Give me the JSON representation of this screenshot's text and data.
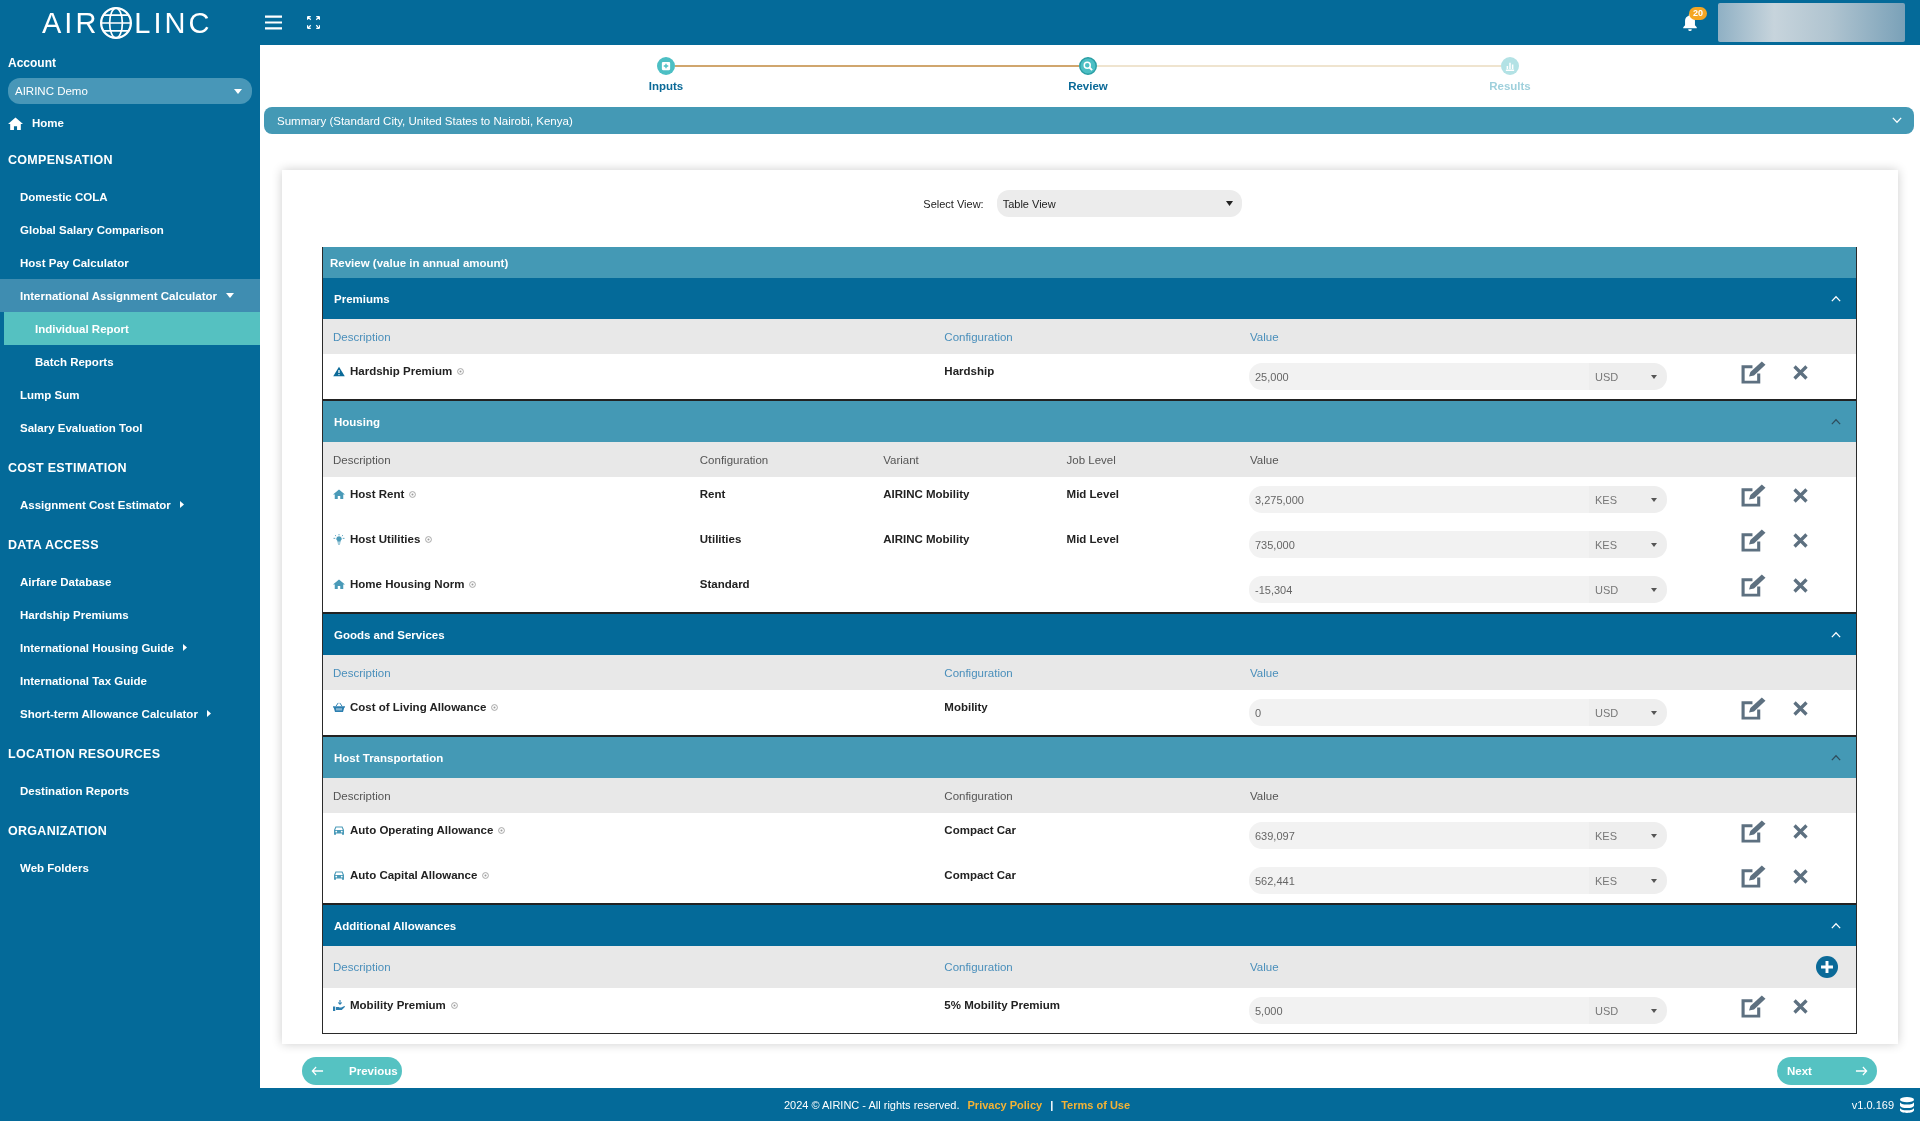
{
  "header": {
    "logo_text": [
      "AIR",
      "LINC"
    ],
    "notification_count": "20"
  },
  "sidebar": {
    "account_label": "Account",
    "account": "AIRINC Demo",
    "home": {
      "label": "Home",
      "selected": false
    },
    "sections": [
      {
        "title": "COMPENSATION",
        "items": [
          {
            "label": "Domestic COLA",
            "selected": false
          },
          {
            "label": "Global Salary Comparison",
            "selected": false
          },
          {
            "label": "Host Pay Calculator",
            "selected": false
          },
          {
            "label": "International Assignment Calculator",
            "selected": false,
            "expanded": true,
            "children": [
              {
                "label": "Individual Report",
                "selected": true
              },
              {
                "label": "Batch Reports",
                "selected": false
              }
            ]
          },
          {
            "label": "Lump Sum",
            "selected": false
          },
          {
            "label": "Salary Evaluation Tool",
            "selected": false
          }
        ]
      },
      {
        "title": "COST ESTIMATION",
        "items": [
          {
            "label": "Assignment Cost Estimator",
            "selected": false,
            "expanded": false
          }
        ]
      },
      {
        "title": "DATA ACCESS",
        "items": [
          {
            "label": "Airfare Database",
            "selected": false
          },
          {
            "label": "Hardship Premiums",
            "selected": false
          },
          {
            "label": "International Housing Guide",
            "selected": false,
            "expanded": false
          },
          {
            "label": "International Tax Guide",
            "selected": false
          },
          {
            "label": "Short-term Allowance Calculator",
            "selected": false,
            "expanded": false
          }
        ]
      },
      {
        "title": "LOCATION RESOURCES",
        "items": [
          {
            "label": "Destination Reports",
            "selected": false
          }
        ]
      },
      {
        "title": "ORGANIZATION",
        "items": [
          {
            "label": "Web Folders",
            "selected": false
          }
        ]
      }
    ]
  },
  "stepper": [
    {
      "label": "Inputs",
      "completed": true,
      "selected": false
    },
    {
      "label": "Review",
      "completed": false,
      "selected": true
    },
    {
      "label": "Results",
      "completed": false,
      "selected": false
    }
  ],
  "summary": {
    "title": "Summary (Standard City, United States to Nairobi, Kenya)",
    "expanded": false
  },
  "view_selector": {
    "label": "Select View:",
    "value": "Table View"
  },
  "review": {
    "title": "Review (value in annual amount)",
    "sections": [
      {
        "title": "Premiums",
        "expanded": true,
        "columns": [
          "Description",
          "Configuration",
          "Value"
        ],
        "rows": [
          {
            "kind": "hardship",
            "cells": [
              "Hardship Premium",
              "Hardship",
              "25,000"
            ],
            "currency": "USD"
          }
        ]
      },
      {
        "title": "Housing",
        "expanded": true,
        "columns": [
          "Description",
          "Configuration",
          "Variant",
          "Job Level",
          "Value"
        ],
        "rows": [
          {
            "kind": "housing",
            "cells": [
              "Host Rent",
              "Rent",
              "AIRINC Mobility",
              "Mid Level",
              "3,275,000"
            ],
            "currency": "KES"
          },
          {
            "kind": "utilities",
            "cells": [
              "Host Utilities",
              "Utilities",
              "AIRINC Mobility",
              "Mid Level",
              "735,000"
            ],
            "currency": "KES"
          },
          {
            "kind": "housing",
            "cells": [
              "Home Housing Norm",
              "Standard",
              "",
              "",
              "-15,304"
            ],
            "currency": "USD"
          }
        ]
      },
      {
        "title": "Goods and Services",
        "expanded": true,
        "columns": [
          "Description",
          "Configuration",
          "Value"
        ],
        "rows": [
          {
            "kind": "goods",
            "cells": [
              "Cost of Living Allowance",
              "Mobility",
              "0"
            ],
            "currency": "USD"
          }
        ]
      },
      {
        "title": "Host Transportation",
        "expanded": true,
        "columns": [
          "Description",
          "Configuration",
          "Value"
        ],
        "rows": [
          {
            "kind": "transport",
            "cells": [
              "Auto Operating Allowance",
              "Compact Car",
              "639,097"
            ],
            "currency": "KES"
          },
          {
            "kind": "transport",
            "cells": [
              "Auto Capital Allowance",
              "Compact Car",
              "562,441"
            ],
            "currency": "KES"
          }
        ]
      },
      {
        "title": "Additional Allowances",
        "expanded": true,
        "addable": true,
        "columns": [
          "Description",
          "Configuration",
          "Value"
        ],
        "rows": [
          {
            "kind": "premium",
            "cells": [
              "Mobility Premium",
              "5% Mobility Premium",
              "5,000"
            ],
            "currency": "USD"
          }
        ]
      }
    ]
  },
  "pager": {
    "previous": "Previous",
    "next": "Next"
  },
  "footer": {
    "copyright": "2024 © AIRINC - All rights reserved.",
    "links": [
      "Privacy Policy",
      "Terms of Use"
    ],
    "link_separator": "|",
    "version": "v1.0.169"
  }
}
